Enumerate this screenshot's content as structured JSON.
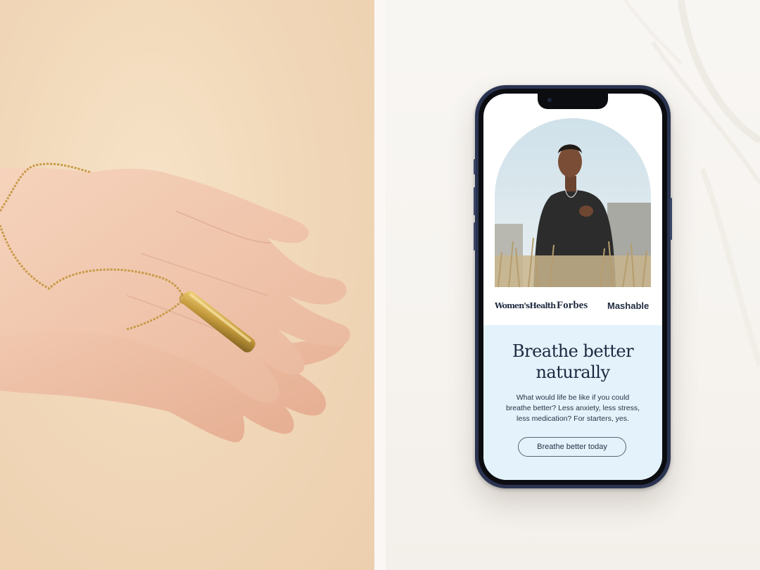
{
  "press": {
    "logos": [
      "Women'sHealth",
      "Forbes",
      "Mashable"
    ]
  },
  "content": {
    "headline_line1": "Breathe better",
    "headline_line2": "naturally",
    "body_line1": "What would life be like if you could",
    "body_line2": "breathe better? Less anxiety, less stress,",
    "body_line3": "less medication? For starters, yes.",
    "cta_label": "Breathe better today"
  },
  "colors": {
    "left_background": "#f1d8b9",
    "right_background": "#f7f4f0",
    "phone_frame": "#2a3350",
    "screen_bottom_background": "#e3f2fb",
    "text_primary": "#1d2840"
  }
}
